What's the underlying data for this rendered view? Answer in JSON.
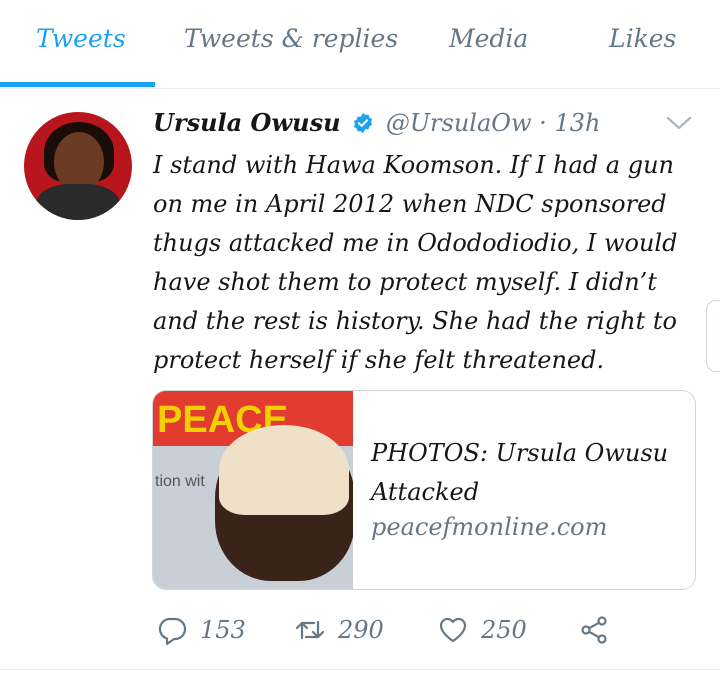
{
  "tabs": [
    {
      "label": "Tweets",
      "active": true
    },
    {
      "label": "Tweets & replies",
      "active": false
    },
    {
      "label": "Media",
      "active": false
    },
    {
      "label": "Likes",
      "active": false
    }
  ],
  "tweet": {
    "author_name": "Ursula Owusu",
    "handle": "@UrsulaOw",
    "separator": "·",
    "time": "13h",
    "verified": true,
    "text": "I stand with Hawa Koomson. If I had a gun on me in April 2012 when NDC sponsored thugs attacked me in Odododiodio, I would have shot them to protect myself. I didn’t and the rest is history. She had the right to protect herself if she felt threatened.",
    "card": {
      "title": "PHOTOS: Ursula Owusu Attacked",
      "domain": "peacefmonline.com",
      "image_text": "PEACE",
      "image_watermark": "tion wit"
    },
    "actions": {
      "replies": "153",
      "retweets": "290",
      "likes": "250"
    }
  },
  "colors": {
    "accent": "#1da1f2",
    "muted": "#657786",
    "verified": "#1da1f2"
  },
  "icons": [
    "verified-badge-icon",
    "chevron-down-icon",
    "reply-icon",
    "retweet-icon",
    "like-icon",
    "share-icon"
  ]
}
